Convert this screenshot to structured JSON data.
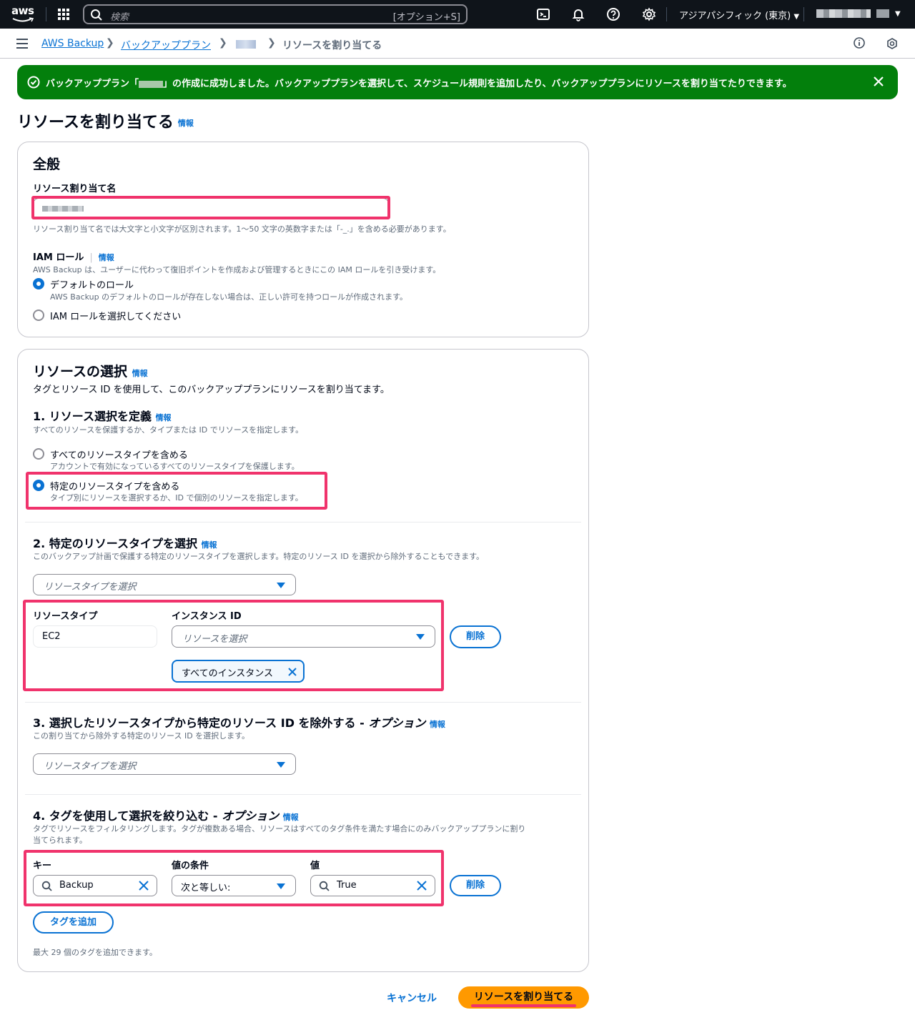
{
  "topnav": {
    "logo": "aws",
    "search_placeholder": "検索",
    "search_shortcut": "[オプション+S]",
    "region": "アジアパシフィック (東京)"
  },
  "breadcrumb": {
    "items": [
      "AWS Backup",
      "バックアッププラン",
      "リソースを割り当てる"
    ]
  },
  "flash": {
    "message_pre": "バックアッププラン「",
    "message_post": "」の作成に成功しました。バックアッププランを選択して、スケジュール規則を追加したり、バックアッププランにリソースを割り当てたりできます。"
  },
  "page": {
    "title": "リソースを割り当てる",
    "info": "情報"
  },
  "general": {
    "title": "全般",
    "name_label": "リソース割り当て名",
    "name_hint": "リソース割り当て名では大文字と小文字が区別されます。1〜50 文字の英数字または「-_.」を含める必要があります。",
    "iam_label": "IAM ロール",
    "iam_info": "情報",
    "iam_desc": "AWS Backup は、ユーザーに代わって復旧ポイントを作成および管理するときにこの IAM ロールを引き受けます。",
    "default_role": "デフォルトのロール",
    "default_role_desc": "AWS Backup のデフォルトのロールが存在しない場合は、正しい許可を持つロールが作成されます。",
    "choose_role": "IAM ロールを選択してください"
  },
  "selection": {
    "title": "リソースの選択",
    "info": "情報",
    "desc": "タグとリソース ID を使用して、このバックアッププランにリソースを割り当てます。",
    "step1": {
      "title": "1. リソース選択を定義",
      "desc": "すべてのリソースを保護するか、タイプまたは ID でリソースを指定します。",
      "opt_all": "すべてのリソースタイプを含める",
      "opt_all_desc": "アカウントで有効になっているすべてのリソースタイプを保護します。",
      "opt_specific": "特定のリソースタイプを含める",
      "opt_specific_desc": "タイプ別にリソースを選択するか、ID で個別のリソースを指定します。"
    },
    "step2": {
      "title": "2. 特定のリソースタイプを選択",
      "desc": "このバックアップ計画で保護する特定のリソースタイプを選択します。特定のリソース ID を選択から除外することもできます。",
      "select_placeholder": "リソースタイプを選択",
      "col_type": "リソースタイプ",
      "col_instance": "インスタンス ID",
      "type_value": "EC2",
      "instance_placeholder": "リソースを選択",
      "token": "すべてのインスタンス",
      "remove": "削除"
    },
    "step3": {
      "title": "3. 選択したリソースタイプから特定のリソース ID を除外する - ",
      "title_opt": "オプション",
      "desc": "この割り当てから除外する特定のリソース ID を選択します。",
      "select_placeholder": "リソースタイプを選択"
    },
    "step4": {
      "title": "4. タグを使用して選択を絞り込む - ",
      "title_opt": "オプション",
      "desc1": "タグでリソースをフィルタリングします。タグが複数ある場合、リソースはすべてのタグ条件を満たす場合にのみバックアッププランに割り",
      "desc2": "当てられます。",
      "col_key": "キー",
      "col_cond": "値の条件",
      "col_value": "値",
      "key_value": "Backup",
      "cond_value": "次と等しい:",
      "value_value": "True",
      "remove": "削除",
      "add_tag": "タグを追加",
      "limit": "最大 29 個のタグを追加できます。"
    }
  },
  "footer": {
    "cancel": "キャンセル",
    "submit": "リソースを割り当てる"
  },
  "colors": {
    "accent": "#0972d3",
    "success": "#037f0c",
    "primary_btn": "#ff9900",
    "highlight": "#f0336c"
  }
}
